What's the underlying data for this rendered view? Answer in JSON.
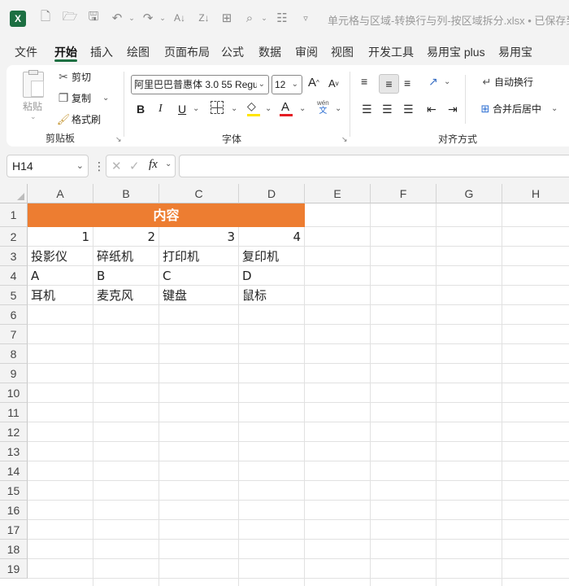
{
  "titlebar": {
    "logo": "X",
    "title": "单元格与区域-转换行与列-按区域拆分.xlsx • 已保存到这"
  },
  "menu": [
    "文件",
    "开始",
    "插入",
    "绘图",
    "页面布局",
    "公式",
    "数据",
    "审阅",
    "视图",
    "开发工具",
    "易用宝 plus",
    "易用宝"
  ],
  "ribbon": {
    "clipboard": {
      "paste": "粘贴",
      "cut": "剪切",
      "copy": "复制",
      "format_painter": "格式刷",
      "group": "剪贴板"
    },
    "font": {
      "name": "阿里巴巴普惠体 3.0 55 Regu",
      "size": "12",
      "bold": "B",
      "italic": "I",
      "underline": "U",
      "grow": "A",
      "shrink": "A",
      "fill_color": "#ffe500",
      "font_color": "#e51c23",
      "phonetic_top": "wén",
      "phonetic_bottom": "文",
      "group": "字体"
    },
    "alignment": {
      "wrap": "自动换行",
      "merge": "合并后居中",
      "group": "对齐方式"
    }
  },
  "formula_bar": {
    "name_box": "H14",
    "fx": "fx",
    "value": ""
  },
  "grid": {
    "columns": [
      "A",
      "B",
      "C",
      "D",
      "E",
      "F",
      "G",
      "H"
    ],
    "rows": [
      "1",
      "2",
      "3",
      "4",
      "5",
      "6",
      "7",
      "8",
      "9",
      "10",
      "11",
      "12",
      "13",
      "14",
      "15",
      "16",
      "17",
      "18",
      "19"
    ],
    "merged_header": "内容",
    "merged_color": "#ed7d31",
    "row2": [
      "1",
      "2",
      "3",
      "4"
    ],
    "row3": [
      "投影仪",
      "碎纸机",
      "打印机",
      "复印机"
    ],
    "row4": [
      "A",
      "B",
      "C",
      "D"
    ],
    "row5": [
      "耳机",
      "麦克风",
      "键盘",
      "鼠标"
    ]
  }
}
